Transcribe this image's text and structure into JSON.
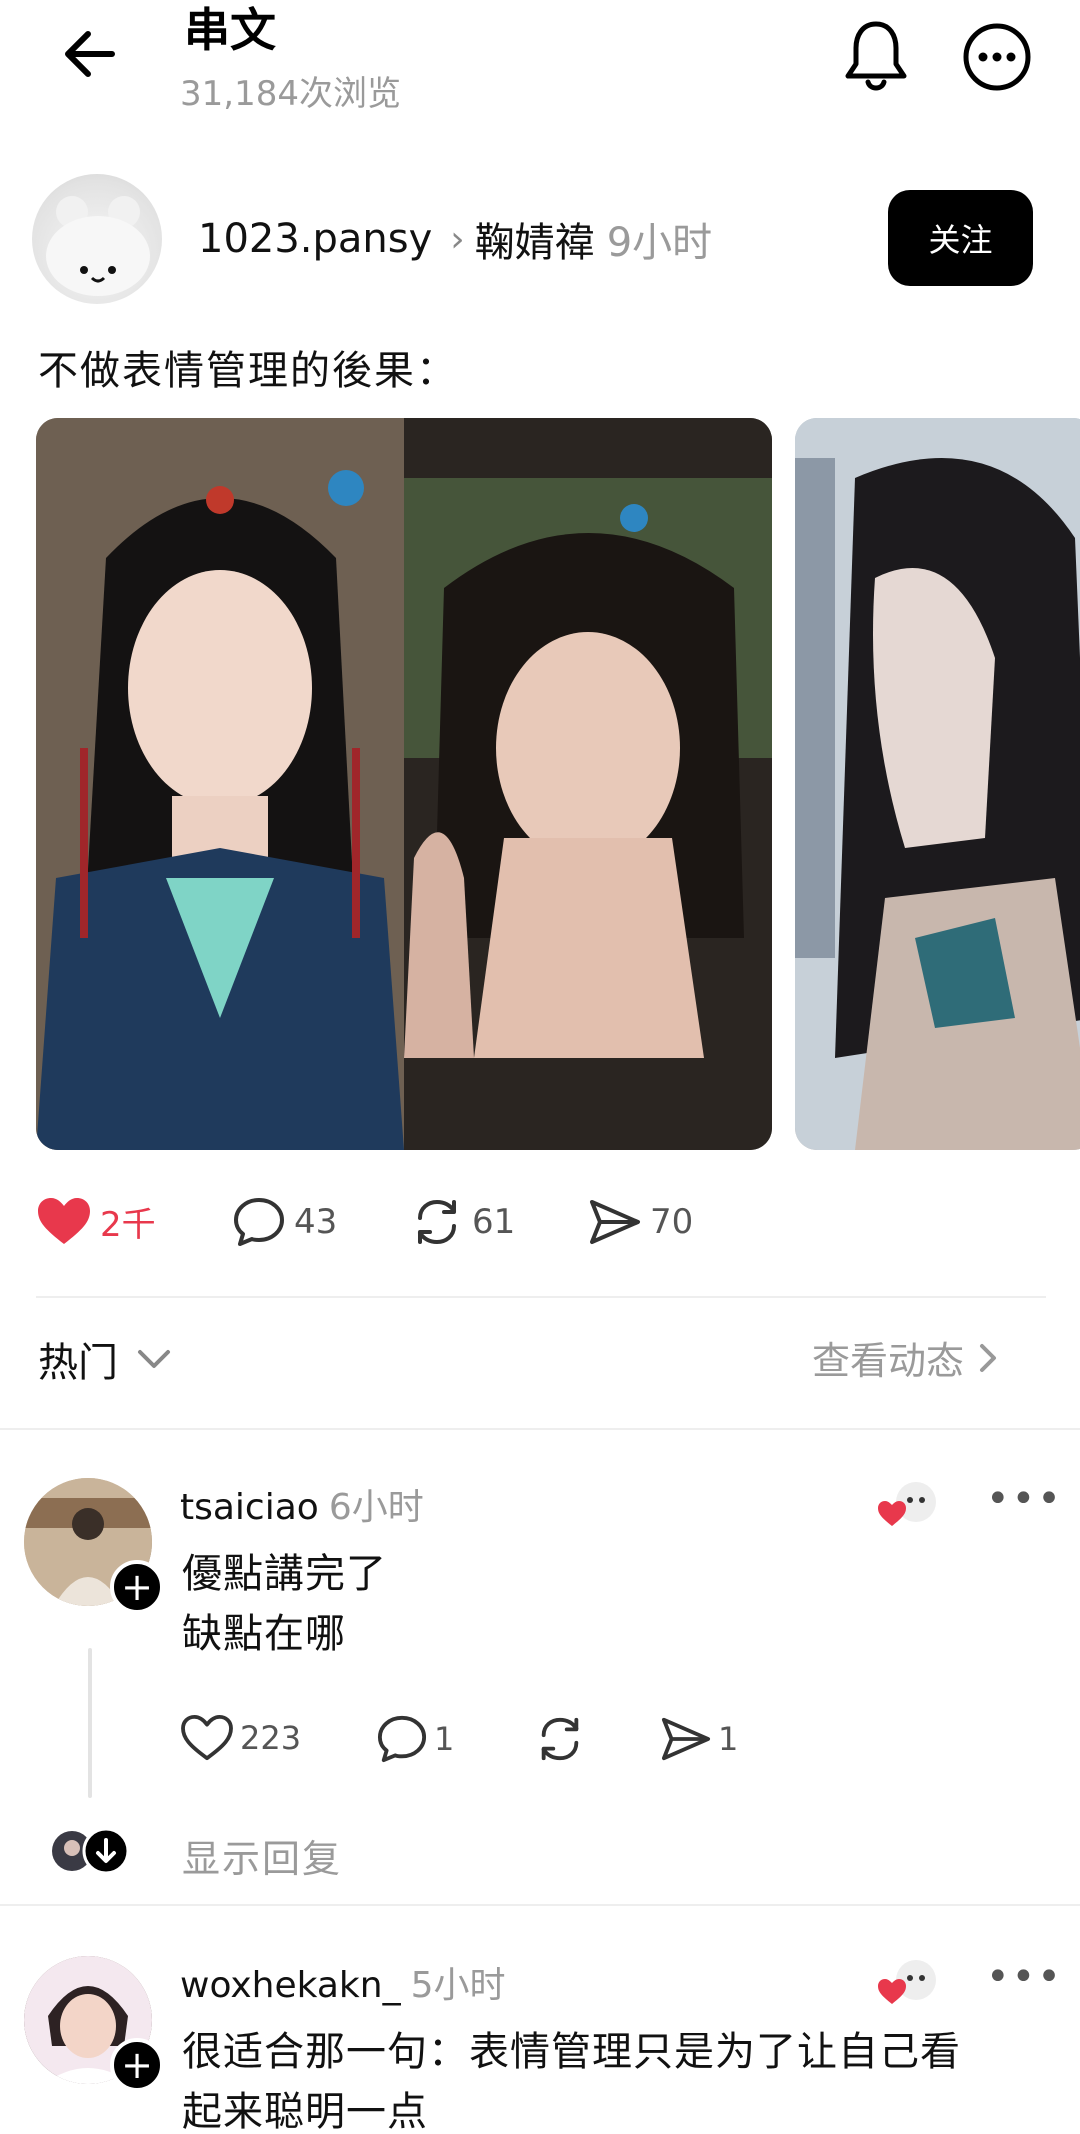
{
  "header": {
    "title": "串文",
    "views": "31,184次浏览"
  },
  "post": {
    "author": "1023.pansy",
    "reply_to": "鞠婧禕",
    "time": "9小时",
    "follow_label": "关注",
    "text": "不做表情管理的後果：",
    "actions": {
      "likes": "2千",
      "comments": "43",
      "reposts": "61",
      "shares": "70"
    },
    "colors": {
      "like": "#e8384c"
    }
  },
  "filter": {
    "sort_label": "热门",
    "view_activity": "查看动态"
  },
  "comments": [
    {
      "username": "tsaiciao",
      "time": "6小时",
      "lines": [
        "優點講完了",
        "缺點在哪"
      ],
      "likes": "223",
      "comments": "1",
      "shares": "1",
      "show_replies": "显示回复"
    },
    {
      "username": "woxhekakn_",
      "time": "5小时",
      "lines": [
        "很适合那一句：表情管理只是为了让自己看",
        "起来聪明一点"
      ]
    }
  ]
}
